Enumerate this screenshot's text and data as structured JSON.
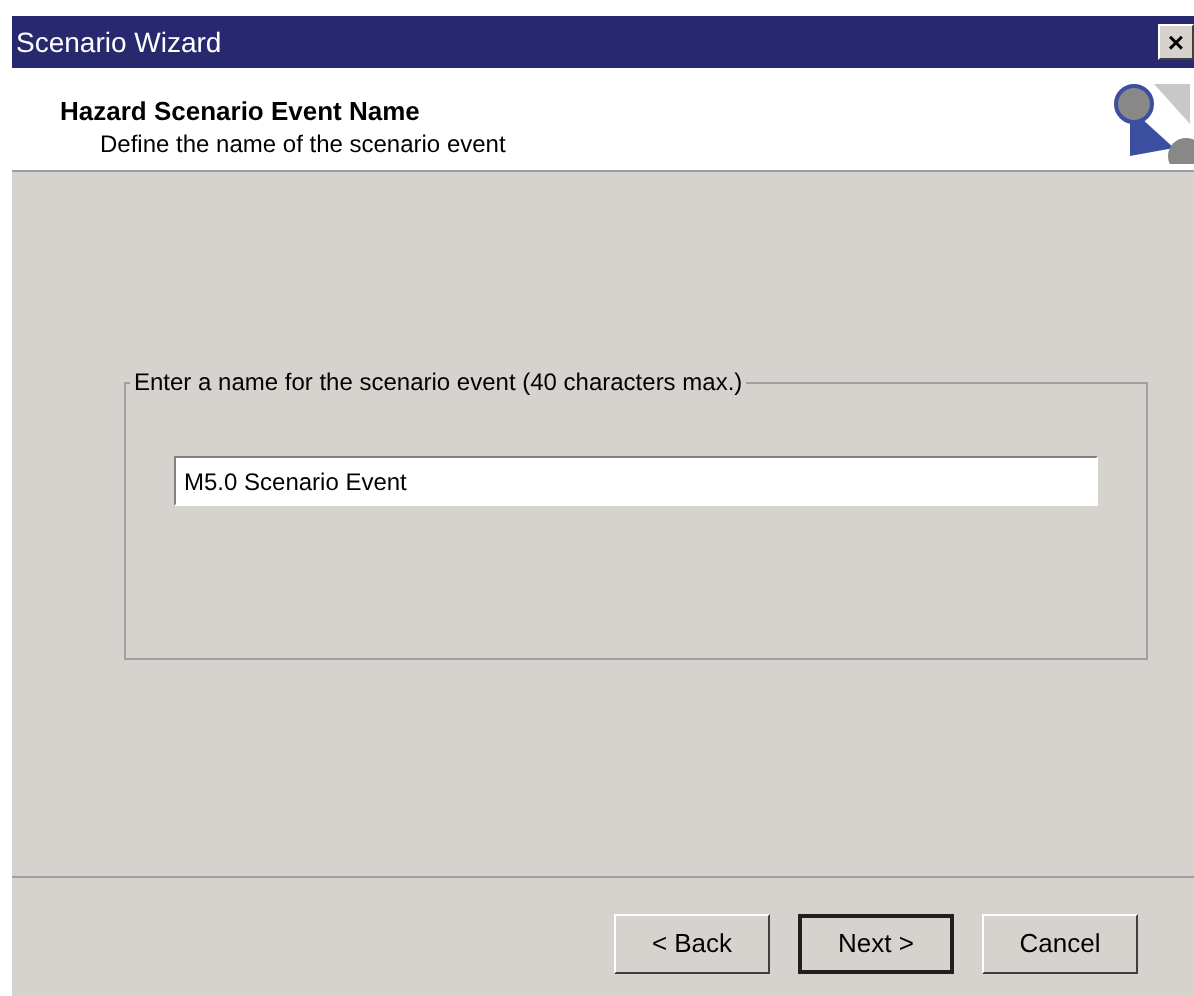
{
  "window": {
    "title": "Scenario Wizard",
    "close": "×"
  },
  "header": {
    "title": "Hazard Scenario Event Name",
    "subtitle": "Define the name of the scenario event"
  },
  "group": {
    "label": "Enter a name for the scenario event (40 characters max.)",
    "field": {
      "value": "M5.0 Scenario Event"
    }
  },
  "buttons": [
    {
      "label": "< Back",
      "default": false
    },
    {
      "label": "Next >",
      "default": true
    },
    {
      "label": "Cancel",
      "default": false
    }
  ]
}
